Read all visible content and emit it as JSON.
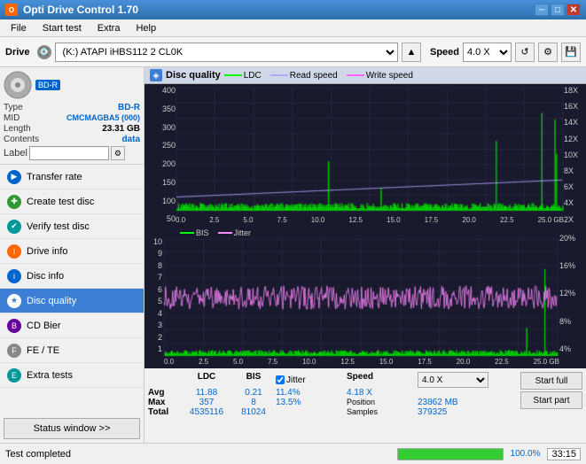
{
  "titlebar": {
    "title": "Opti Drive Control 1.70",
    "icon": "O",
    "minimize": "─",
    "maximize": "□",
    "close": "✕"
  },
  "menu": {
    "items": [
      "File",
      "Start test",
      "Extra",
      "Help"
    ]
  },
  "toolbar": {
    "drive_label": "Drive",
    "drive_value": "(K:) ATAPI iHBS112  2 CL0K",
    "speed_label": "Speed",
    "speed_value": "4.0 X"
  },
  "disc": {
    "type": "BD-R",
    "type_label": "Type",
    "mid_label": "MID",
    "mid_value": "CMCMAGBA5 (000)",
    "length_label": "Length",
    "length_value": "23.31 GB",
    "contents_label": "Contents",
    "contents_value": "data",
    "label_label": "Label"
  },
  "nav": {
    "items": [
      {
        "id": "transfer-rate",
        "label": "Transfer rate",
        "icon": "▶",
        "color": "blue"
      },
      {
        "id": "create-test-disc",
        "label": "Create test disc",
        "icon": "✚",
        "color": "green"
      },
      {
        "id": "verify-test-disc",
        "label": "Verify test disc",
        "icon": "✔",
        "color": "teal"
      },
      {
        "id": "drive-info",
        "label": "Drive info",
        "icon": "i",
        "color": "orange"
      },
      {
        "id": "disc-info",
        "label": "Disc info",
        "icon": "i",
        "color": "blue"
      },
      {
        "id": "disc-quality",
        "label": "Disc quality",
        "icon": "★",
        "color": "active",
        "active": true
      },
      {
        "id": "cd-bier",
        "label": "CD Bier",
        "icon": "B",
        "color": "purple"
      },
      {
        "id": "fe-te",
        "label": "FE / TE",
        "icon": "F",
        "color": "gray"
      },
      {
        "id": "extra-tests",
        "label": "Extra tests",
        "icon": "E",
        "color": "teal"
      }
    ],
    "status_btn": "Status window >>"
  },
  "chart": {
    "title": "Disc quality",
    "legend": {
      "ldc": "LDC",
      "read_speed": "Read speed",
      "write_speed": "Write speed",
      "bis": "BIS",
      "jitter": "Jitter"
    },
    "top": {
      "y_max": 400,
      "y_right_max": 18,
      "x_max": 25.0
    },
    "bottom": {
      "y_max": 10,
      "y_right_max": 20,
      "x_max": 25.0
    }
  },
  "stats": {
    "headers": [
      "",
      "LDC",
      "BIS",
      "",
      "Jitter",
      "Speed"
    ],
    "rows": [
      {
        "label": "Avg",
        "ldc": "11.88",
        "bis": "0.21",
        "jitter": "11.4%",
        "speed": "4.18 X"
      },
      {
        "label": "Max",
        "ldc": "357",
        "bis": "8",
        "jitter": "13.5%",
        "position": "23862 MB"
      },
      {
        "label": "Total",
        "ldc": "4535116",
        "bis": "81024",
        "samples": "379325"
      }
    ],
    "jitter_checked": true,
    "jitter_label": "Jitter",
    "speed_display": "4.0 X",
    "btn_start_full": "Start full",
    "btn_start_part": "Start part"
  },
  "statusbar": {
    "text": "Test completed",
    "progress_pct": 100,
    "time": "33:15"
  }
}
